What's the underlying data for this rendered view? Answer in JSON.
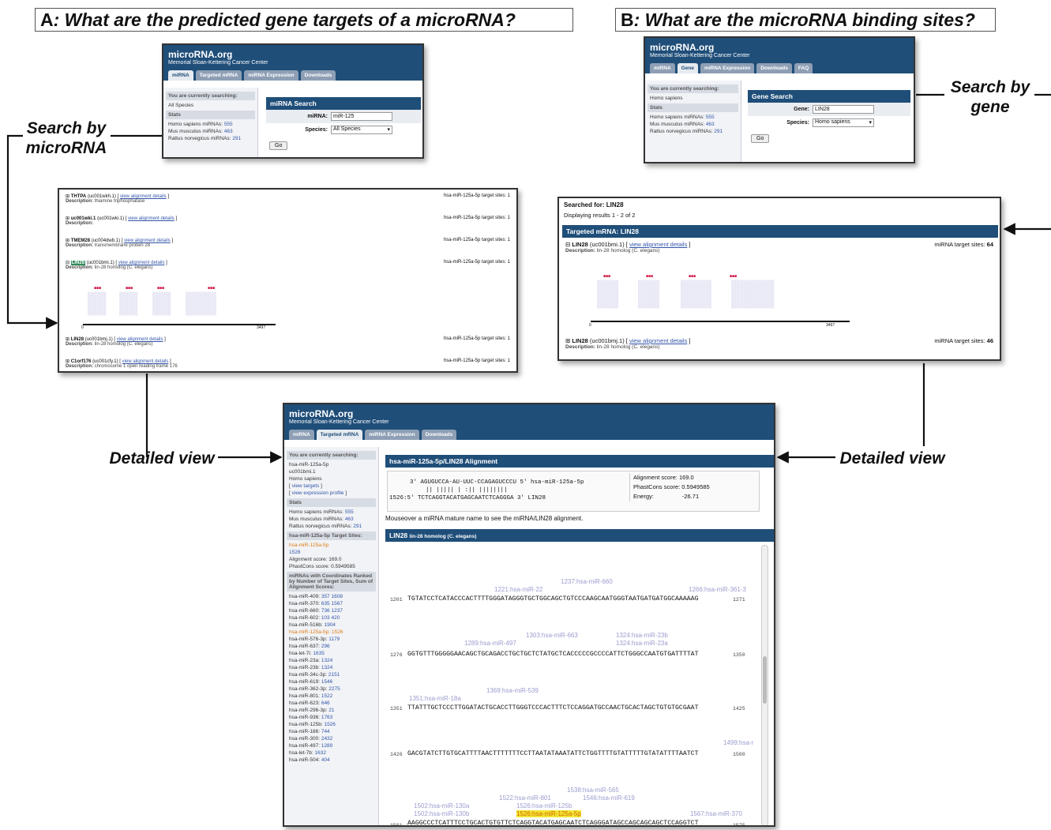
{
  "panel_a": {
    "title_letter": "A",
    "title_rest": ": What are the predicted gene targets of a microRNA?",
    "callout_search": [
      "Search by",
      "microRNA"
    ]
  },
  "panel_b": {
    "title_letter": "B",
    "title_rest": ": What are the microRNA binding sites?",
    "callout_search": [
      "Search by",
      "gene"
    ]
  },
  "callout_detail_left": "Detailed view",
  "callout_detail_right": "Detailed view",
  "site": {
    "brand": "microRNA.org",
    "institution": "Memorial Sloan-Kettering Cancer Center"
  },
  "mirna_search_shot": {
    "tabs": [
      "miRNA",
      "Targeted mRNA",
      "miRNA Expression",
      "Downloads"
    ],
    "searching_header": "You are currently searching:",
    "searching_item": "All Species",
    "stats_header": "Stats",
    "stats": [
      {
        "label": "Homo sapiens miRNAs:",
        "value": "555"
      },
      {
        "label": "Mus musculus miRNAs:",
        "value": "463"
      },
      {
        "label": "Rattus norvegicus miRNAs:",
        "value": "291"
      }
    ],
    "panel_title": "miRNA Search",
    "mirna_label": "miRNA:",
    "mirna_value": "miR-125",
    "species_label": "Species:",
    "species_value": "All Species",
    "go": "Go"
  },
  "gene_search_shot": {
    "tabs": [
      "miRNA",
      "Gene",
      "miRNA Expression",
      "Downloads",
      "FAQ"
    ],
    "searching_header": "You are currently searching:",
    "searching_item": "Homo sapiens",
    "stats_header": "Stats",
    "stats": [
      {
        "label": "Homo sapiens miRNAs:",
        "value": "555"
      },
      {
        "label": "Mus musculus miRNAs:",
        "value": "463"
      },
      {
        "label": "Rattus norvegicus miRNAs:",
        "value": "291"
      }
    ],
    "panel_title": "Gene Search",
    "gene_label": "Gene:",
    "gene_value": "LIN28",
    "species_label": "Species:",
    "species_value": "Homo sapiens",
    "go": "Go"
  },
  "mirna_results": {
    "link_text": "view alignment details",
    "rows": [
      {
        "gene": "THTPA",
        "id": "(uc001wkh.1)",
        "desc": "thiamine triphosphatase",
        "sites": "hsa-miR-125a-5p target sites: 1"
      },
      {
        "gene": "uc001wki.1",
        "id": "(uc001wki.1)",
        "desc": "",
        "sites": "hsa-miR-125a-5p target sites: 1"
      },
      {
        "gene": "TMEM28",
        "id": "(uc004dwb.1)",
        "desc": "transmembrane protein 28",
        "sites": "hsa-miR-125a-5p target sites: 1"
      },
      {
        "gene": "LIN28",
        "id": "(uc001bmi.1)",
        "desc": "lin-28 homolog (C. elegans)",
        "sites": "hsa-miR-125a-5p target sites: 1"
      },
      {
        "gene": "LIN28",
        "id": "(uc001bmj.1)",
        "desc": "lin-28 homolog (C. elegans)",
        "sites": "hsa-miR-125a-5p target sites: 1"
      },
      {
        "gene": "C1orf176",
        "id": "(uc001cfy.1)",
        "desc": "chromosome 1 open reading frame 176",
        "sites": "hsa-miR-125a-5p target sites: 1"
      }
    ],
    "desc_label": "Description:",
    "axis_start": "0",
    "axis_end": "3497"
  },
  "gene_results": {
    "searched_for": "Searched for: LIN28",
    "displaying": "Displaying results 1 - 2 of 2",
    "panel_title": "Targeted mRNA: LIN28",
    "link_text": "view alignment details",
    "desc_label": "Description:",
    "rows": [
      {
        "gene": "LIN28",
        "id": "(uc001bmi.1)",
        "desc": "lin-28 homolog (C. elegans)",
        "sites_label": "miRNA target sites:",
        "sites": "64"
      },
      {
        "gene": "LIN28",
        "id": "(uc001bmj.1)",
        "desc": "lin-28 homolog (C. elegans)",
        "sites_label": "miRNA target sites:",
        "sites": "46"
      }
    ],
    "axis_start": "0",
    "axis_end": "3497"
  },
  "detail_shot": {
    "tabs": [
      "miRNA",
      "Targeted mRNA",
      "miRNA Expression",
      "Downloads"
    ],
    "searching_header": "You are currently searching:",
    "searching_items": [
      "hsa-miR-125a-5p",
      "uc001bmi.1",
      "Homo sapiens"
    ],
    "view_targets": "view targets",
    "view_profile": "view expression profile",
    "stats_header": "Stats",
    "stats": [
      {
        "label": "Homo sapiens miRNAs:",
        "value": "555"
      },
      {
        "label": "Mus musculus miRNAs:",
        "value": "463"
      },
      {
        "label": "Rattus norvegicus miRNAs:",
        "value": "291"
      }
    ],
    "target_sites_header": "hsa-miR-125a-5p Target Sites:",
    "target_site_name": "hsa-miR-125a-5p",
    "target_site_pos": "1526",
    "target_site_align": "Alignment score: 169.0",
    "target_site_phast": "PhastCons score: 0.5949585",
    "ranked_header": "miRNAs with Coordinates Ranked by Number of Target Sites, Sum of Alignment Scores:",
    "ranked": [
      {
        "name": "hsa-miR-409:",
        "pos": "357 1608"
      },
      {
        "name": "hsa-miR-370:",
        "pos": "635 1567"
      },
      {
        "name": "hsa-miR-660:",
        "pos": "736 1237"
      },
      {
        "name": "hsa-miR-602:",
        "pos": "103 420"
      },
      {
        "name": "hsa-miR-516b:",
        "pos": "1904"
      },
      {
        "name": "hsa-miR-125a-5p:",
        "pos": "1526",
        "hl": true
      },
      {
        "name": "hsa-miR-576-3p:",
        "pos": "1179"
      },
      {
        "name": "hsa-miR-637:",
        "pos": "296"
      },
      {
        "name": "hsa-let-7i:",
        "pos": "1635"
      },
      {
        "name": "hsa-miR-23a:",
        "pos": "1324"
      },
      {
        "name": "hsa-miR-23b:",
        "pos": "1324"
      },
      {
        "name": "hsa-miR-34c-3p:",
        "pos": "2151"
      },
      {
        "name": "hsa-miR-619:",
        "pos": "1546"
      },
      {
        "name": "hsa-miR-362-3p:",
        "pos": "2275"
      },
      {
        "name": "hsa-miR-801:",
        "pos": "1522"
      },
      {
        "name": "hsa-miR-623:",
        "pos": "646"
      },
      {
        "name": "hsa-miR-296-3p:",
        "pos": "21"
      },
      {
        "name": "hsa-miR-936:",
        "pos": "1763"
      },
      {
        "name": "hsa-miR-125b:",
        "pos": "1526"
      },
      {
        "name": "hsa-miR-186:",
        "pos": "744"
      },
      {
        "name": "hsa-miR-300:",
        "pos": "2432"
      },
      {
        "name": "hsa-miR-497:",
        "pos": "1289"
      },
      {
        "name": "hsa-let-7b:",
        "pos": "1632"
      },
      {
        "name": "hsa-miR-504:",
        "pos": "404"
      }
    ],
    "align_title": "hsa-miR-125a-5p/LIN28 Alignment",
    "align_line1": "3' AGUGUCCA-AU-UUC-CCAGAGUCCCU 5' hsa-miR-125a-5p",
    "align_line2": "|| ||||| | :|| ||||||||",
    "align_line3": "1526:5' TCTCAGGTACATGAGCAATCTCAGGGA 3' LIN28",
    "align_score": "Alignment score: 169.0",
    "phast_score": "PhastCons score: 0.5949585",
    "energy_label": "Energy:",
    "energy_value": "-26.71",
    "mouseover": "Mouseover a miRNA mature name to see the miRNA/LIN28 alignment.",
    "seq_title": "LIN28",
    "seq_subtitle": "lin-28 homolog (C. elegans)",
    "seq_lines": [
      {
        "start": "1201",
        "seq": "TGTATCCTCATACCCACTTTTGGGATAGGGTGCTGGCAGCTGTCCCAAGCAATGGGTAATGATGATGGCAAAAAG",
        "end": "1271"
      },
      {
        "start": "1276",
        "seq": "GGTGTTTGGGGGAACAGCTGCAGACCTGCTGCTCTATGCTCACCCCCGCCCCATTCTGGGCCAATGTGATTTTAT",
        "end": "1350"
      },
      {
        "start": "1351",
        "seq": "TTATTTGCTCCCTTGGATACTGCACCTTGGGTCCCACTTTCTCCAGGATGCCAACTGCACTAGCTGTGTGCGAAT",
        "end": "1425"
      },
      {
        "start": "1426",
        "seq": "GACGTATCTTGTGCATTTTAACTTTTTTTCCTTAATATAAATATTCTGGTTTTGTATTTTTGTATATTTTAATCT",
        "end": "1500"
      },
      {
        "start": "1501",
        "seq": "AAGGCCCTCATTTCCTGCACTGTGTTCTCAGGTACATGAGCAATCTCAGGGATAGCCAGCAGCAGCTCCAGGTCT",
        "end": "1575"
      }
    ],
    "mirna_labels": [
      "1221:hsa-miR-22",
      "1237:hsa-miR-660",
      "1266:hsa-miR-361-3",
      "1289:hsa-miR-497",
      "1303:hsa-miR-663",
      "1324:hsa-miR-23b",
      "1324:hsa-miR-23a",
      "1351:hsa-miR-18a",
      "1369:hsa-miR-539",
      "1499:hsa-r",
      "1538:hsa-miR-565",
      "1522:hsa-miR-801",
      "1546:hsa-miR-619",
      "1502:hsa-miR-130a",
      "1526:hsa-miR-125b",
      "1502:hsa-miR-130b",
      "1526:hsa-miR-125a-5p",
      "1567:hsa-miR-370"
    ]
  }
}
